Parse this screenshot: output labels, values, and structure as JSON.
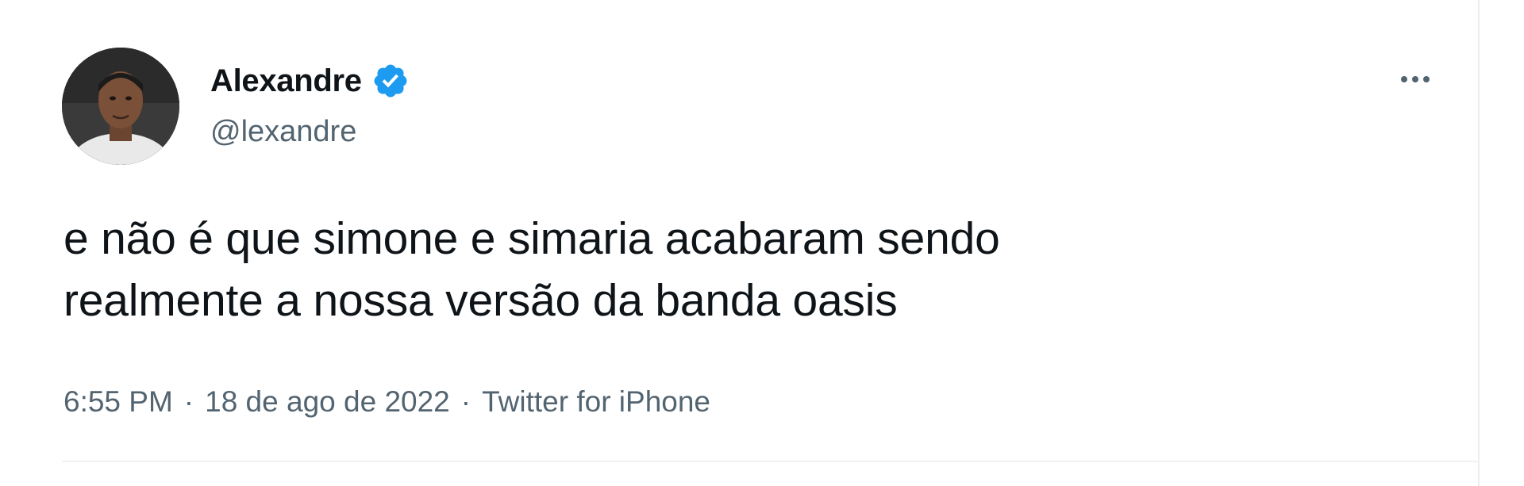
{
  "colors": {
    "text_primary": "#0f1419",
    "text_secondary": "#536471",
    "verified_blue": "#1d9bf0",
    "divider": "#eff3f4"
  },
  "tweet": {
    "author": {
      "display_name": "Alexandre",
      "handle": "@lexandre",
      "verified": true,
      "verified_icon": "verified-badge-icon",
      "avatar_icon": "avatar-photo"
    },
    "more_icon": "more-horizontal-icon",
    "text_lines": [
      "e não é que simone e simaria acabaram sendo",
      "realmente a nossa versão da banda oasis"
    ],
    "meta": {
      "time": "6:55 PM",
      "separator": "·",
      "date": "18 de ago de 2022",
      "source": "Twitter for iPhone"
    }
  }
}
